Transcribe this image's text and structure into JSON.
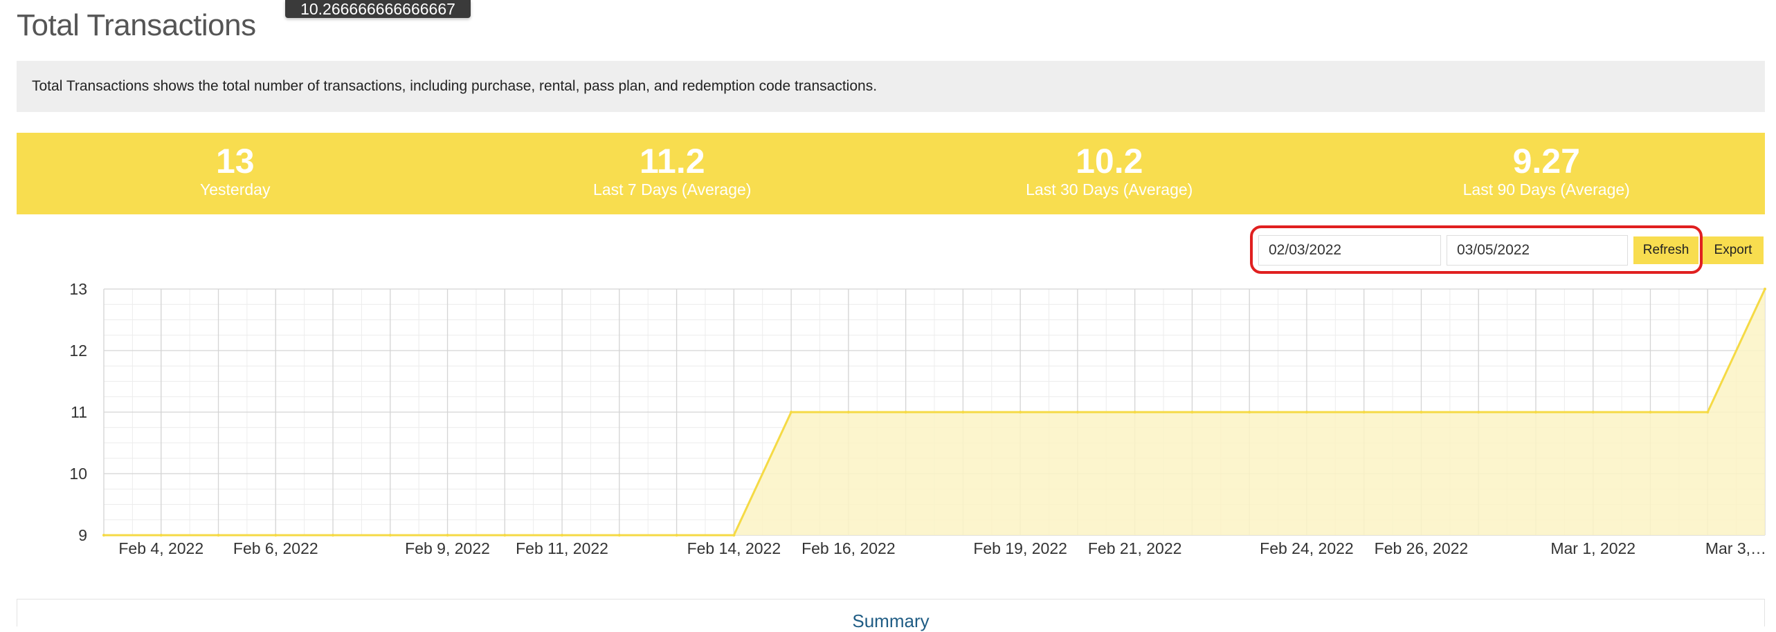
{
  "tooltip": {
    "text": "10.266666666666667"
  },
  "page": {
    "title": "Total Transactions",
    "description": "Total Transactions shows the total number of transactions, including purchase, rental, pass plan, and redemption code transactions."
  },
  "stats": [
    {
      "value": "13",
      "label": "Yesterday"
    },
    {
      "value": "11.2",
      "label": "Last 7 Days (Average)"
    },
    {
      "value": "10.2",
      "label": "Last 30 Days (Average)"
    },
    {
      "value": "9.27",
      "label": "Last 90 Days (Average)"
    }
  ],
  "controls": {
    "start_date": "02/03/2022",
    "end_date": "03/05/2022",
    "refresh_label": "Refresh",
    "export_label": "Export"
  },
  "summary": {
    "title": "Summary"
  },
  "colors": {
    "accent": "#f8dd4f",
    "line": "#f5da45",
    "area": "#fcf3c4",
    "highlight": "#e02020",
    "grid_major": "#d4d4d4",
    "grid_minor": "#ececec"
  },
  "chart_data": {
    "type": "area",
    "x_axis": "date",
    "x": [
      "2022-02-03",
      "2022-02-04",
      "2022-02-05",
      "2022-02-06",
      "2022-02-07",
      "2022-02-08",
      "2022-02-09",
      "2022-02-10",
      "2022-02-11",
      "2022-02-12",
      "2022-02-13",
      "2022-02-14",
      "2022-02-15",
      "2022-02-16",
      "2022-02-17",
      "2022-02-18",
      "2022-02-19",
      "2022-02-20",
      "2022-02-21",
      "2022-02-22",
      "2022-02-23",
      "2022-02-24",
      "2022-02-25",
      "2022-02-26",
      "2022-02-27",
      "2022-02-28",
      "2022-03-01",
      "2022-03-02",
      "2022-03-03",
      "2022-03-04"
    ],
    "series": [
      {
        "values": [
          9,
          9,
          9,
          9,
          9,
          9,
          9,
          9,
          9,
          9,
          9,
          9,
          11,
          11,
          11,
          11,
          11,
          11,
          11,
          11,
          11,
          11,
          11,
          11,
          11,
          11,
          11,
          11,
          11,
          13
        ]
      }
    ],
    "tick_labels": [
      "Feb 4, 2022",
      "Feb 6, 2022",
      "Feb 9, 2022",
      "Feb 11, 2022",
      "Feb 14, 2022",
      "Feb 16, 2022",
      "Feb 19, 2022",
      "Feb 21, 2022",
      "Feb 24, 2022",
      "Feb 26, 2022",
      "Mar 1, 2022",
      "Mar 3,…"
    ],
    "tick_dates": [
      "2022-02-04",
      "2022-02-06",
      "2022-02-09",
      "2022-02-11",
      "2022-02-14",
      "2022-02-16",
      "2022-02-19",
      "2022-02-21",
      "2022-02-24",
      "2022-02-26",
      "2022-03-01",
      "2022-03-03"
    ],
    "yticks": [
      9,
      10,
      11,
      12,
      13
    ],
    "ylim": [
      9,
      13
    ],
    "xlim": [
      "2022-02-03",
      "2022-03-04"
    ],
    "grid": true,
    "legend": false
  }
}
